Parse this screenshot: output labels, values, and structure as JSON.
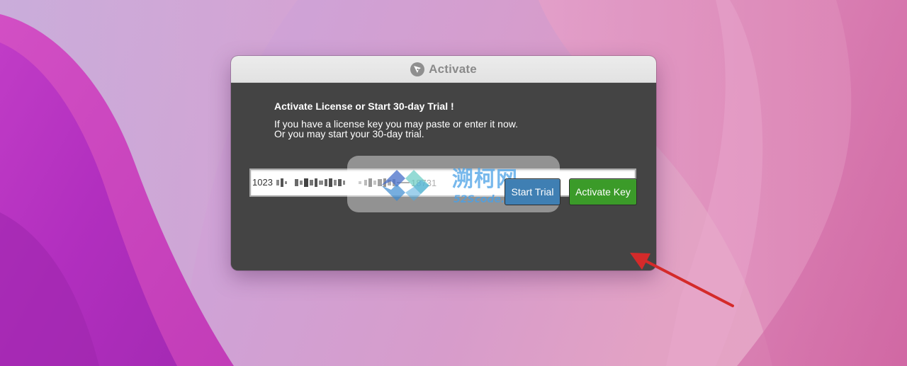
{
  "window": {
    "title": "Activate",
    "heading": "Activate License or Start 30-day Trial !",
    "description_line1": "If you have a license key you may paste or enter it now.",
    "description_line2": "Or you may start your 30-day trial."
  },
  "license_field": {
    "prefix": "1023",
    "suffix": "18731",
    "value_obscured": true
  },
  "buttons": {
    "start_trial": "Start Trial",
    "activate_key": "Activate Key"
  },
  "watermark": {
    "cn_text": "溯柯网",
    "en_text": "52Scode.CoM"
  },
  "colors": {
    "start_trial_button": "#3f7fb3",
    "activate_key_button": "#3b9b29",
    "dialog_background": "#444444",
    "annotation_arrow": "#d42a2a"
  },
  "icons": {
    "app_icon": "pen-nib-circle-icon",
    "watermark_logo": "diamond-logo-icon",
    "annotation": "red-arrow-icon"
  }
}
